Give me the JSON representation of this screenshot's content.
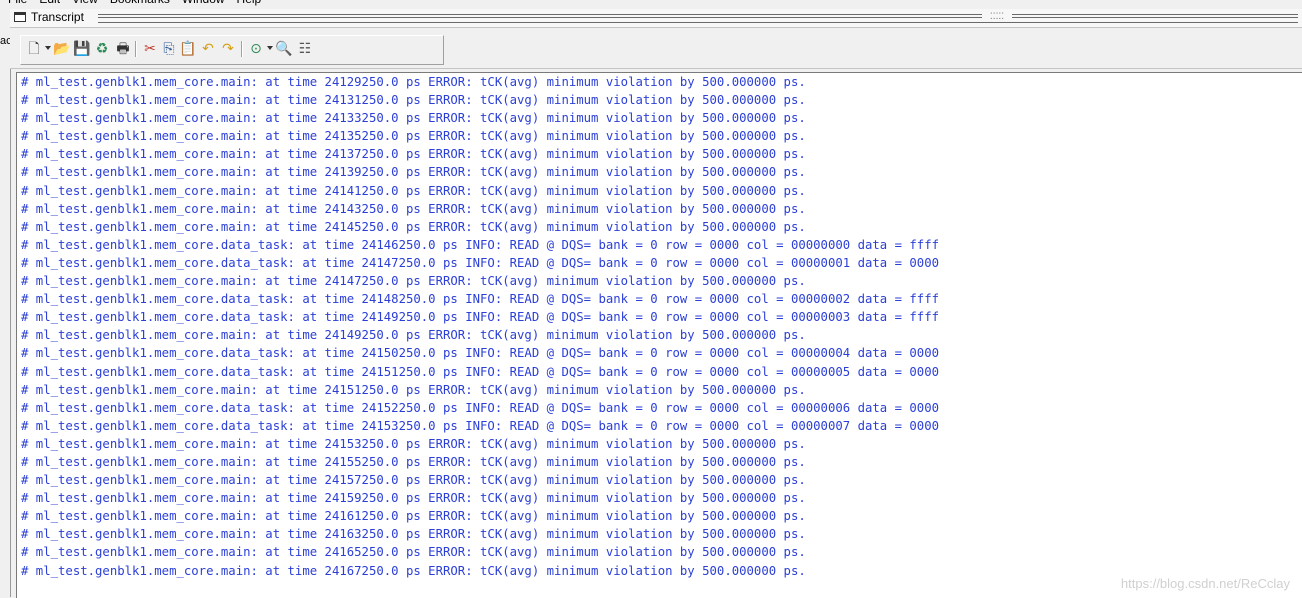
{
  "menu": {
    "items": [
      "File",
      "Edit",
      "View",
      "Bookmarks",
      "Window",
      "Help"
    ]
  },
  "left_strip_text": "ac",
  "window": {
    "title": "Transcript",
    "grip": "⁚⁚⁚⁚⁚"
  },
  "toolbar": {
    "buttons": [
      {
        "name": "new-file-icon",
        "glyph": "🗋",
        "color": "#333333"
      },
      {
        "name": "open-folder-icon",
        "glyph": "📂",
        "color": "#d4a017"
      },
      {
        "name": "save-icon",
        "glyph": "💾",
        "color": "#1f4e9c"
      },
      {
        "name": "reload-icon",
        "glyph": "♻",
        "color": "#2e8b57"
      },
      {
        "name": "print-icon",
        "glyph": "🖶",
        "color": "#333333"
      },
      {
        "name": "cut-icon",
        "glyph": "✂",
        "color": "#c0392b"
      },
      {
        "name": "copy-icon",
        "glyph": "⎘",
        "color": "#2b5797"
      },
      {
        "name": "paste-icon",
        "glyph": "📋",
        "color": "#8b5a2b"
      },
      {
        "name": "undo-icon",
        "glyph": "↶",
        "color": "#d4a017"
      },
      {
        "name": "redo-icon",
        "glyph": "↷",
        "color": "#d4a017"
      },
      {
        "name": "compile-icon",
        "glyph": "⊙",
        "color": "#2e8b57"
      },
      {
        "name": "find-icon",
        "glyph": "🔍",
        "color": "#333333"
      },
      {
        "name": "format-icon",
        "glyph": "☷",
        "color": "#555555"
      }
    ]
  },
  "transcript": {
    "text_color": "#2b3fd6",
    "lines": [
      "# ml_test.genblk1.mem_core.main: at time 24129250.0 ps ERROR: tCK(avg) minimum violation by 500.000000 ps.",
      "# ml_test.genblk1.mem_core.main: at time 24131250.0 ps ERROR: tCK(avg) minimum violation by 500.000000 ps.",
      "# ml_test.genblk1.mem_core.main: at time 24133250.0 ps ERROR: tCK(avg) minimum violation by 500.000000 ps.",
      "# ml_test.genblk1.mem_core.main: at time 24135250.0 ps ERROR: tCK(avg) minimum violation by 500.000000 ps.",
      "# ml_test.genblk1.mem_core.main: at time 24137250.0 ps ERROR: tCK(avg) minimum violation by 500.000000 ps.",
      "# ml_test.genblk1.mem_core.main: at time 24139250.0 ps ERROR: tCK(avg) minimum violation by 500.000000 ps.",
      "# ml_test.genblk1.mem_core.main: at time 24141250.0 ps ERROR: tCK(avg) minimum violation by 500.000000 ps.",
      "# ml_test.genblk1.mem_core.main: at time 24143250.0 ps ERROR: tCK(avg) minimum violation by 500.000000 ps.",
      "# ml_test.genblk1.mem_core.main: at time 24145250.0 ps ERROR: tCK(avg) minimum violation by 500.000000 ps.",
      "# ml_test.genblk1.mem_core.data_task: at time 24146250.0 ps INFO: READ @ DQS= bank = 0 row = 0000 col = 00000000 data = ffff",
      "# ml_test.genblk1.mem_core.data_task: at time 24147250.0 ps INFO: READ @ DQS= bank = 0 row = 0000 col = 00000001 data = 0000",
      "# ml_test.genblk1.mem_core.main: at time 24147250.0 ps ERROR: tCK(avg) minimum violation by 500.000000 ps.",
      "# ml_test.genblk1.mem_core.data_task: at time 24148250.0 ps INFO: READ @ DQS= bank = 0 row = 0000 col = 00000002 data = ffff",
      "# ml_test.genblk1.mem_core.data_task: at time 24149250.0 ps INFO: READ @ DQS= bank = 0 row = 0000 col = 00000003 data = ffff",
      "# ml_test.genblk1.mem_core.main: at time 24149250.0 ps ERROR: tCK(avg) minimum violation by 500.000000 ps.",
      "# ml_test.genblk1.mem_core.data_task: at time 24150250.0 ps INFO: READ @ DQS= bank = 0 row = 0000 col = 00000004 data = 0000",
      "# ml_test.genblk1.mem_core.data_task: at time 24151250.0 ps INFO: READ @ DQS= bank = 0 row = 0000 col = 00000005 data = 0000",
      "# ml_test.genblk1.mem_core.main: at time 24151250.0 ps ERROR: tCK(avg) minimum violation by 500.000000 ps.",
      "# ml_test.genblk1.mem_core.data_task: at time 24152250.0 ps INFO: READ @ DQS= bank = 0 row = 0000 col = 00000006 data = 0000",
      "# ml_test.genblk1.mem_core.data_task: at time 24153250.0 ps INFO: READ @ DQS= bank = 0 row = 0000 col = 00000007 data = 0000",
      "# ml_test.genblk1.mem_core.main: at time 24153250.0 ps ERROR: tCK(avg) minimum violation by 500.000000 ps.",
      "# ml_test.genblk1.mem_core.main: at time 24155250.0 ps ERROR: tCK(avg) minimum violation by 500.000000 ps.",
      "# ml_test.genblk1.mem_core.main: at time 24157250.0 ps ERROR: tCK(avg) minimum violation by 500.000000 ps.",
      "# ml_test.genblk1.mem_core.main: at time 24159250.0 ps ERROR: tCK(avg) minimum violation by 500.000000 ps.",
      "# ml_test.genblk1.mem_core.main: at time 24161250.0 ps ERROR: tCK(avg) minimum violation by 500.000000 ps.",
      "# ml_test.genblk1.mem_core.main: at time 24163250.0 ps ERROR: tCK(avg) minimum violation by 500.000000 ps.",
      "# ml_test.genblk1.mem_core.main: at time 24165250.0 ps ERROR: tCK(avg) minimum violation by 500.000000 ps.",
      "# ml_test.genblk1.mem_core.main: at time 24167250.0 ps ERROR: tCK(avg) minimum violation by 500.000000 ps."
    ]
  },
  "watermark": "https://blog.csdn.net/ReCclay"
}
